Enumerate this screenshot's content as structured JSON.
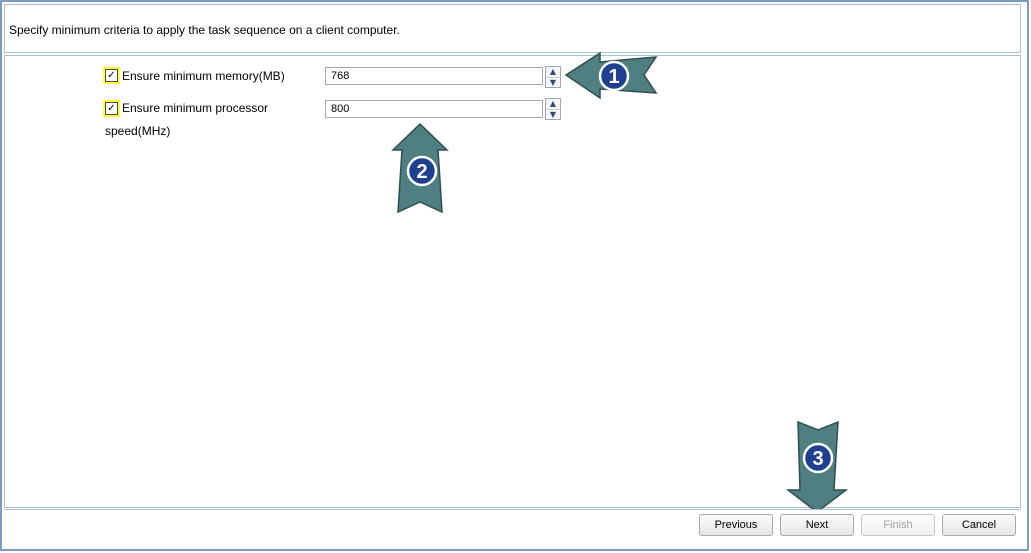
{
  "header": {
    "instruction": "Specify minimum criteria to apply the task sequence on a client computer."
  },
  "criteria": {
    "memory": {
      "checked": true,
      "check_glyph": "✓",
      "label": "Ensure minimum memory(MB)",
      "value": "768"
    },
    "processor": {
      "checked": true,
      "check_glyph": "✓",
      "label_line1": "Ensure minimum processor",
      "label_line2": "speed(MHz)",
      "value": "800"
    }
  },
  "spinner_glyphs": {
    "up": "▲",
    "down": "▼"
  },
  "buttons": {
    "previous": "Previous",
    "next": "Next",
    "finish": "Finish",
    "cancel": "Cancel"
  },
  "annotations": [
    {
      "number": "1",
      "direction": "left"
    },
    {
      "number": "2",
      "direction": "up"
    },
    {
      "number": "3",
      "direction": "down"
    }
  ],
  "colors": {
    "arrow_fill": "#4f7f80",
    "badge_fill": "#1f3f8f",
    "checkbox_highlight": "#ffff33",
    "frame_border": "#7a9cc2"
  }
}
